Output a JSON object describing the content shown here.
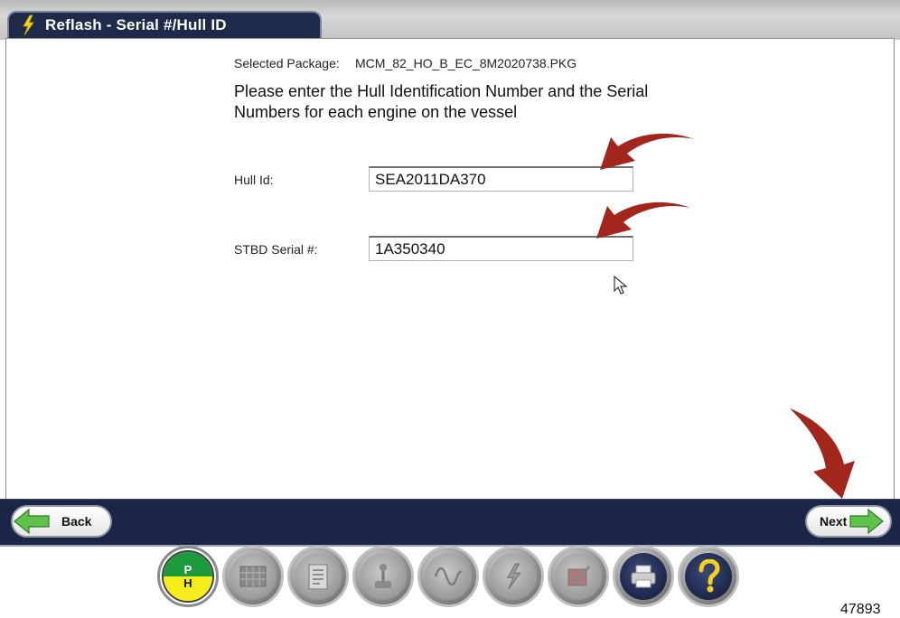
{
  "window": {
    "title": "Reflash - Serial #/Hull ID"
  },
  "package": {
    "label": "Selected Package:",
    "value": "MCM_82_HO_B_EC_8M2020738.PKG"
  },
  "instructions": "Please enter the Hull Identification Number and the Serial Numbers for each engine on the vessel",
  "fields": [
    {
      "label": "Hull Id:",
      "value": "SEA2011DA370"
    },
    {
      "label": "STBD Serial #:",
      "value": "1A350340"
    }
  ],
  "nav": {
    "back_label": "Back",
    "next_label": "Next"
  },
  "toolbar": {
    "ph_top": "P",
    "ph_bottom": "H"
  },
  "figure_number": "47893",
  "colors": {
    "accent_arrow": "#a3261c",
    "nav_bar": "#1b2545",
    "arrow_green": "#5fc24a"
  }
}
